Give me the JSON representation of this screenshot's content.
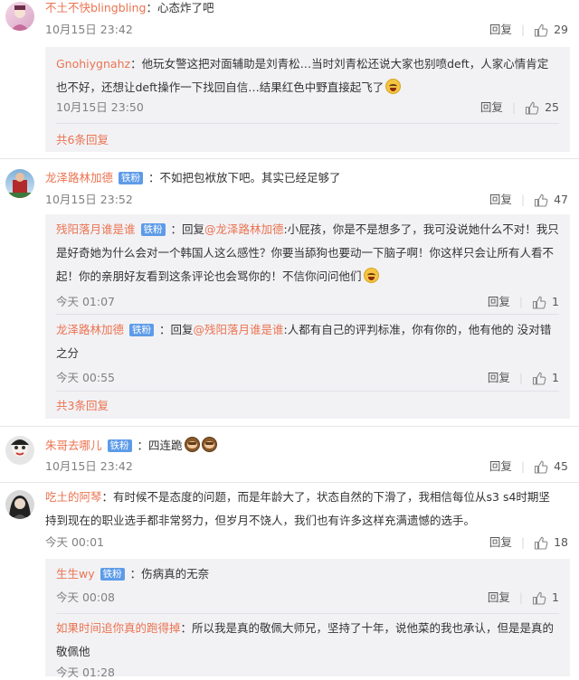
{
  "labels": {
    "reply": "回复",
    "badge": "铁粉"
  },
  "colors": {
    "link": "#eb7350",
    "badge": "#5d9be8",
    "reply_bg": "#f2f2f5"
  },
  "comments": [
    {
      "user": "不土不快blingbling",
      "text": "：心态炸了吧",
      "time": "10月15日 23:42",
      "likes": "29",
      "replies": [
        {
          "user": "Gnohiygnahz",
          "text": "：他玩女警这把对面辅助是刘青松…当时刘青松还说大家也别喷deft，人家心情肯定也不好，还想让deft操作一下找回自信…结果红色中野直接起飞了",
          "time": "10月15日 23:50",
          "likes": "25"
        }
      ],
      "more": "共6条回复"
    },
    {
      "user": "龙泽路林加德",
      "badge": "铁粉",
      "text": "：不如把包袱放下吧。其实已经足够了",
      "time": "10月15日 23:52",
      "likes": "47",
      "replies": [
        {
          "user": "残阳落月谁是谁",
          "badge": "铁粉",
          "reply_word": "：回复",
          "target": "@龙泽路林加德",
          "text": ":小屁孩，你是不是想多了，我可没说她什么不对！我只是好奇她为什么会对一个韩国人这么感性？你要当舔狗也要动一下脑子啊！你这样只会让所有人看不起！你的亲朋好友看到这条评论也会骂你的！不信你问问他们",
          "time": "今天 01:07",
          "likes": "1"
        },
        {
          "user": "龙泽路林加德",
          "badge": "铁粉",
          "reply_word": "：回复",
          "target": "@残阳落月谁是谁",
          "text": ":人都有自己的评判标准，你有你的，他有他的 没对错之分",
          "time": "今天 00:55",
          "likes": "1"
        }
      ],
      "more": "共3条回复"
    },
    {
      "user": "朱哥去哪儿",
      "badge": "铁粉",
      "text": "：四连跪",
      "time": "10月15日 23:42",
      "likes": "45"
    },
    {
      "user": "吃土的阿琴",
      "text": "：有时候不是态度的问题，而是年龄大了，状态自然的下滑了，我相信每位从s3 s4时期坚持到现在的职业选手都非常努力，但岁月不饶人，我们也有许多这样充满遗憾的选手。",
      "time": "今天 00:01",
      "likes": "18",
      "replies": [
        {
          "user": "生生wy",
          "badge": "铁粉",
          "text": "：伤病真的无奈",
          "time": "今天 00:08",
          "likes": "1"
        },
        {
          "user": "如果时间追你真的跑得掉",
          "text": "：所以我是真的敬佩大师兄，坚持了十年，说他菜的我也承认，但是是真的敬佩他",
          "time": "今天 01:28",
          "likes": ""
        }
      ]
    }
  ]
}
